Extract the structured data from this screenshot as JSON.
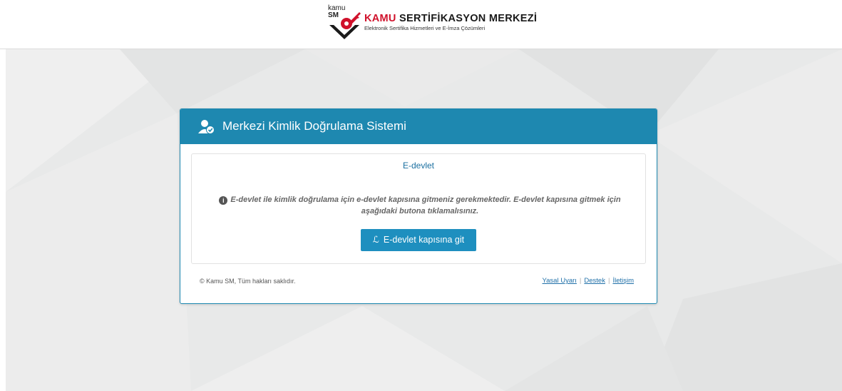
{
  "header": {
    "logo_mark_top": "kamu",
    "logo_mark_bottom": "SM",
    "title_red": "KAMU",
    "title_rest": " SERTİFİKASYON MERKEZİ",
    "subtitle": "Elektronik Sertifika Hizmetleri ve E-İmza Çözümleri"
  },
  "panel": {
    "title": "Merkezi Kimlik Doğrulama Sistemi",
    "section_title": "E-devlet",
    "info_text": "E-devlet ile kimlik doğrulama için e-devlet kapısına gitmeniz gerekmektedir. E-devlet kapısına gitmek için aşağıdaki butona tıklamalısınız.",
    "button_label": "E-devlet kapısına git"
  },
  "footer": {
    "copyright": "Kamu SM, Tüm hakları saklıdır.",
    "links": [
      "Yasal Uyarı",
      "Destek",
      "İletişim"
    ]
  },
  "colors": {
    "accent": "#1e88b0",
    "brand_red": "#d0112b",
    "background": "#e8e9e9"
  },
  "icons": {
    "panel_icon": "user-check-icon",
    "info_icon": "info-icon",
    "button_icon": "link-icon"
  }
}
